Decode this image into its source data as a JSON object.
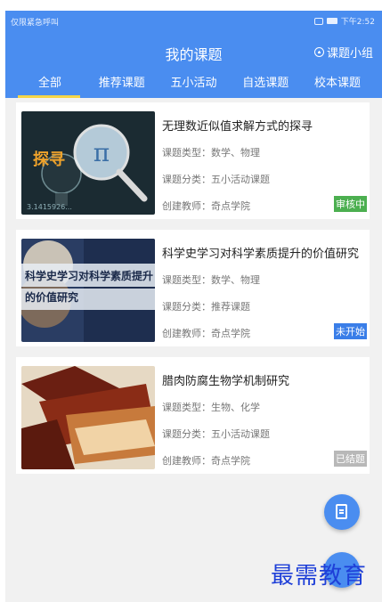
{
  "status": {
    "left": "仅限紧急呼叫",
    "right": "下午2:52"
  },
  "header": {
    "title": "我的课题",
    "group_label": "课题小组"
  },
  "tabs": [
    {
      "label": "全部"
    },
    {
      "label": "推荐课题"
    },
    {
      "label": "五小活动"
    },
    {
      "label": "自选课题"
    },
    {
      "label": "校本课题"
    }
  ],
  "cards": [
    {
      "title": "无理数近似值求解方式的探寻",
      "type": "课题类型：数学、物理",
      "category": "课题分类：五小活动课题",
      "teacher": "创建教师：奇点学院",
      "status": "审核中",
      "status_color": "#4caf50",
      "thumb_text": "探寻",
      "thumb_symbol": "π",
      "thumb_num": "3.1415926..."
    },
    {
      "title": "科学史学习对科学素质提升的价值研究",
      "type": "课题类型：数学、物理",
      "category": "课题分类：推荐课题",
      "teacher": "创建教师：奇点学院",
      "status": "未开始",
      "status_color": "#3a7ee8",
      "thumb_text": "科学史学习对科学素质提升的价值研究"
    },
    {
      "title": "腊肉防腐生物学机制研究",
      "type": "课题类型：生物、化学",
      "category": "课题分类：五小活动课题",
      "teacher": "创建教师：奇点学院",
      "status": "已结题",
      "status_color": "#b8b8b8"
    }
  ],
  "watermark": "最需教育"
}
